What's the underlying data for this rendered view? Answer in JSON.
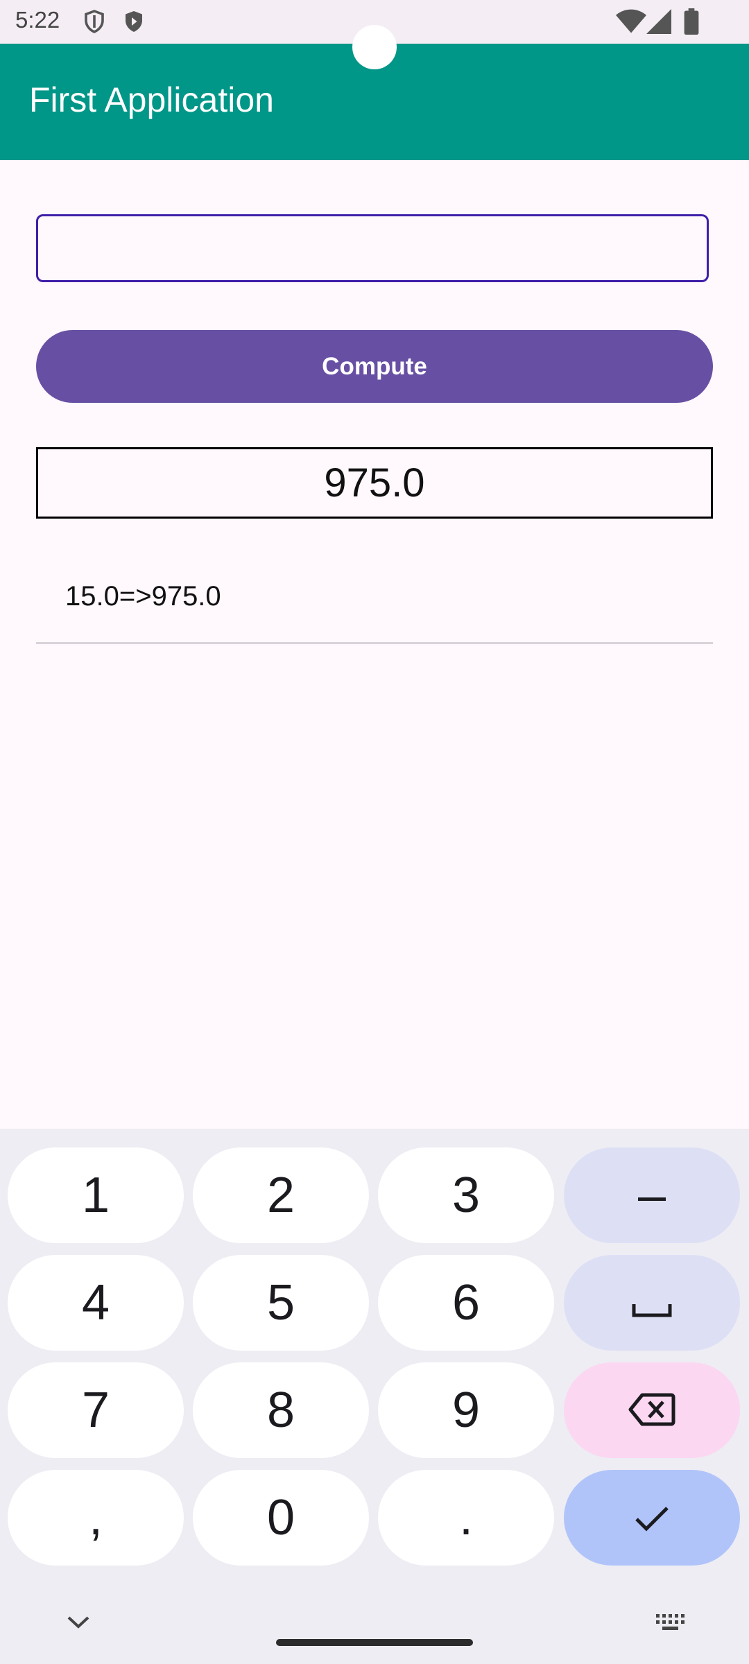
{
  "status_bar": {
    "time": "5:22",
    "icons": [
      "shield-icon",
      "play-protect-icon",
      "wifi-icon",
      "cell-signal-icon",
      "battery-icon"
    ]
  },
  "app_bar": {
    "title": "First Application",
    "color": "#009688"
  },
  "main": {
    "input": {
      "value": "",
      "placeholder": ""
    },
    "compute_label": "Compute",
    "result": "975.0",
    "history": [
      "15.0=>975.0"
    ]
  },
  "keyboard": {
    "rows": [
      [
        "1",
        "2",
        "3",
        "–"
      ],
      [
        "4",
        "5",
        "6",
        "space"
      ],
      [
        "7",
        "8",
        "9",
        "backspace"
      ],
      [
        ",",
        "0",
        ".",
        "done"
      ]
    ],
    "keys": {
      "k1": "1",
      "k2": "2",
      "k3": "3",
      "minus": "–",
      "k4": "4",
      "k5": "5",
      "k6": "6",
      "k7": "7",
      "k8": "8",
      "k9": "9",
      "comma": ",",
      "k0": "0",
      "period": "."
    },
    "bottom_icons": [
      "chevron-down-icon",
      "keyboard-icon"
    ]
  },
  "colors": {
    "accent": "#6750A4",
    "app_bar": "#009688",
    "input_border": "#3F1FA8",
    "keyboard_function_key": "#DDE0F5",
    "keyboard_delete_key": "#FBD7F2",
    "keyboard_done_key": "#B0C4FA"
  }
}
